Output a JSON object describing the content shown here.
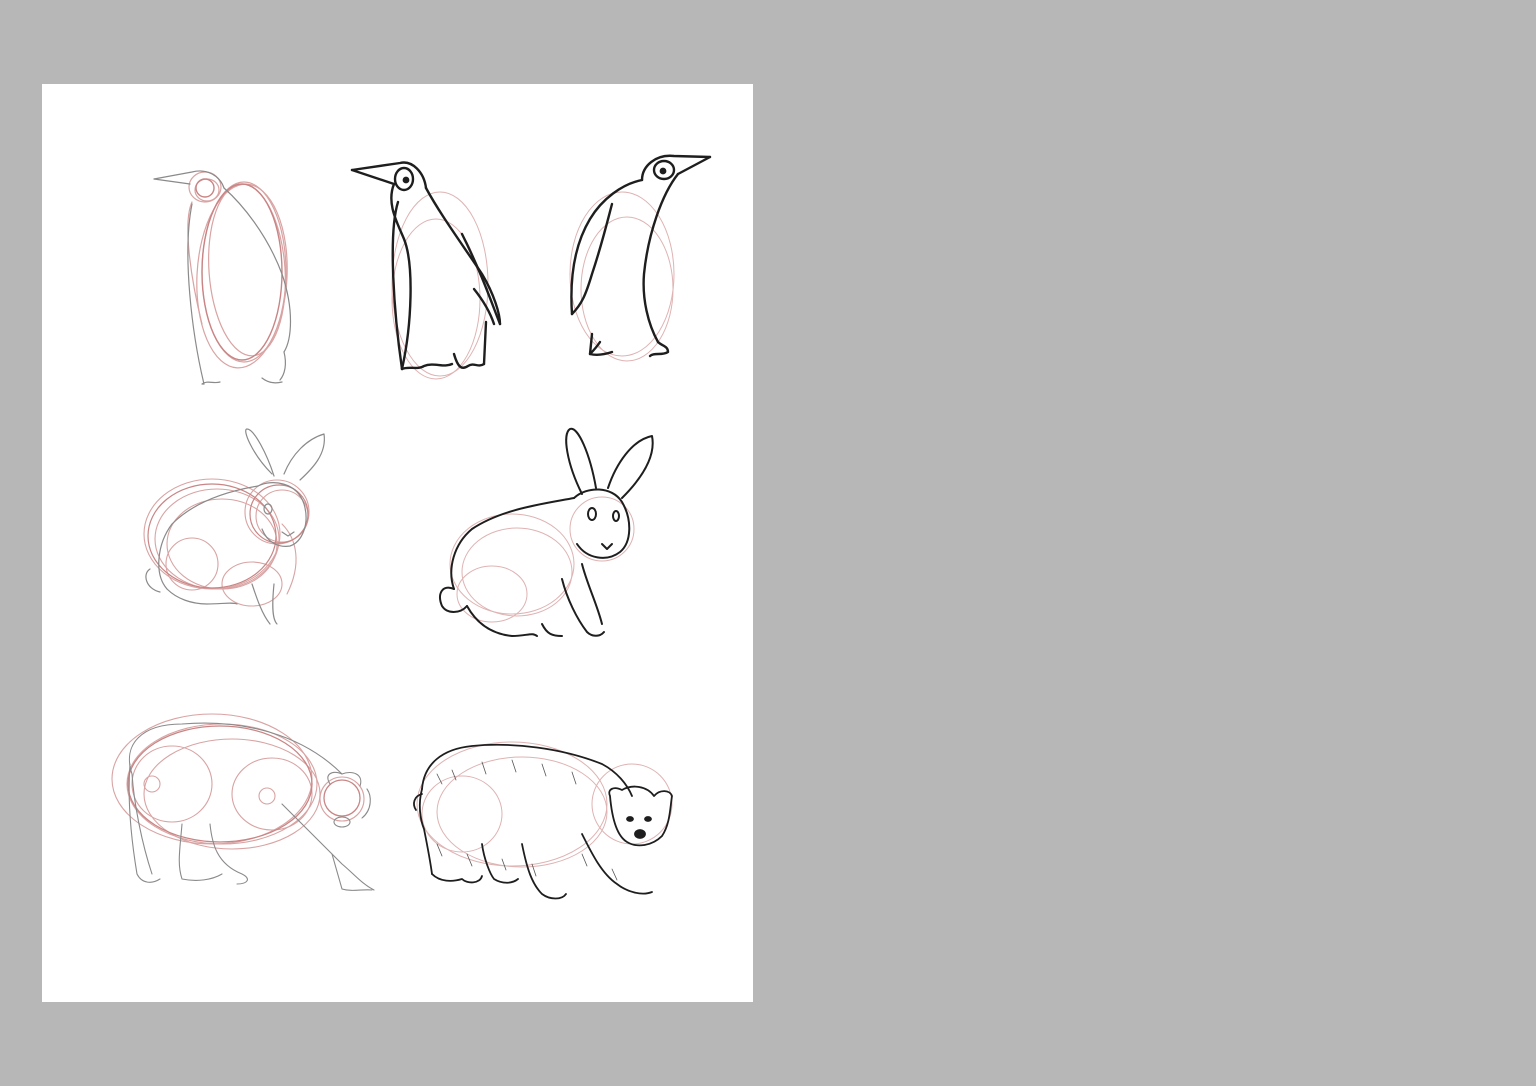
{
  "colors": {
    "workspace_background": "#b7b7b7",
    "page_background": "#ffffff",
    "construction_line": "#d9a3a3",
    "construction_line_dark": "#c98585",
    "light_pencil": "#8a8a8a",
    "ink_line": "#1e1e1e"
  },
  "sketches": [
    {
      "subject": "penguin",
      "stage": "construction"
    },
    {
      "subject": "penguin",
      "stage": "inked"
    },
    {
      "subject": "penguin",
      "stage": "inked"
    },
    {
      "subject": "rabbit",
      "stage": "construction"
    },
    {
      "subject": "rabbit",
      "stage": "inked"
    },
    {
      "subject": "polar-bear",
      "stage": "construction"
    },
    {
      "subject": "polar-bear",
      "stage": "inked"
    }
  ]
}
